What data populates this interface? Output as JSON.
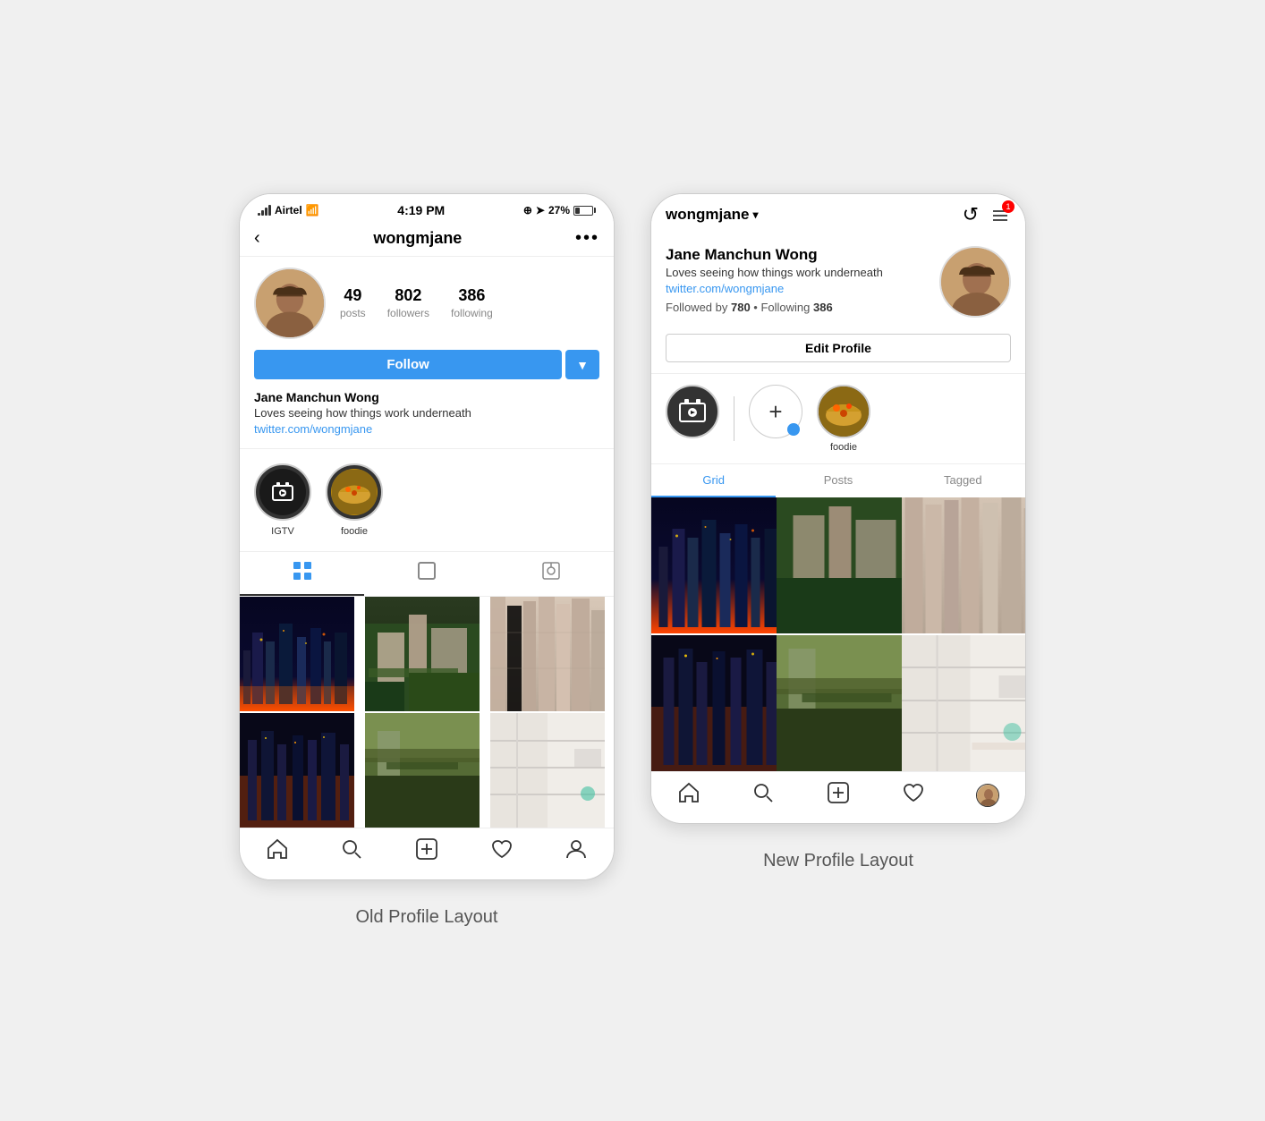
{
  "page": {
    "background": "#f0f0f0",
    "left_label": "Old Profile Layout",
    "right_label": "New Profile Layout"
  },
  "old_layout": {
    "status_bar": {
      "carrier": "Airtel",
      "time": "4:19 PM",
      "battery": "27%"
    },
    "nav": {
      "username": "wongmjane",
      "back_label": "<",
      "more_label": "..."
    },
    "stats": {
      "posts_count": "49",
      "posts_label": "posts",
      "followers_count": "802",
      "followers_label": "followers",
      "following_count": "386",
      "following_label": "following"
    },
    "follow_btn": "Follow",
    "bio": {
      "name": "Jane Manchun Wong",
      "text": "Loves seeing how things work underneath",
      "link": "twitter.com/wongmjane"
    },
    "highlights": [
      {
        "label": "IGTV",
        "type": "igtv"
      },
      {
        "label": "foodie",
        "type": "foodie"
      }
    ],
    "tabs": [
      "grid",
      "posts",
      "tagged"
    ],
    "bottom_nav": [
      "home",
      "search",
      "add",
      "heart",
      "profile"
    ]
  },
  "new_layout": {
    "header": {
      "username": "wongmjane",
      "notification_count": "1"
    },
    "bio": {
      "name": "Jane Manchun Wong",
      "text": "Loves seeing how things work underneath",
      "link": "twitter.com/wongmjane",
      "followed_by": "780",
      "following": "386"
    },
    "edit_profile_btn": "Edit Profile",
    "highlights": [
      {
        "label": "",
        "type": "igtv"
      },
      {
        "label": "",
        "type": "add"
      },
      {
        "label": "foodie",
        "type": "foodie"
      }
    ],
    "tabs": [
      {
        "label": "Grid",
        "active": true
      },
      {
        "label": "Posts",
        "active": false
      },
      {
        "label": "Tagged",
        "active": false
      }
    ],
    "bottom_nav": [
      "home",
      "search",
      "add",
      "heart",
      "profile-pic"
    ]
  }
}
